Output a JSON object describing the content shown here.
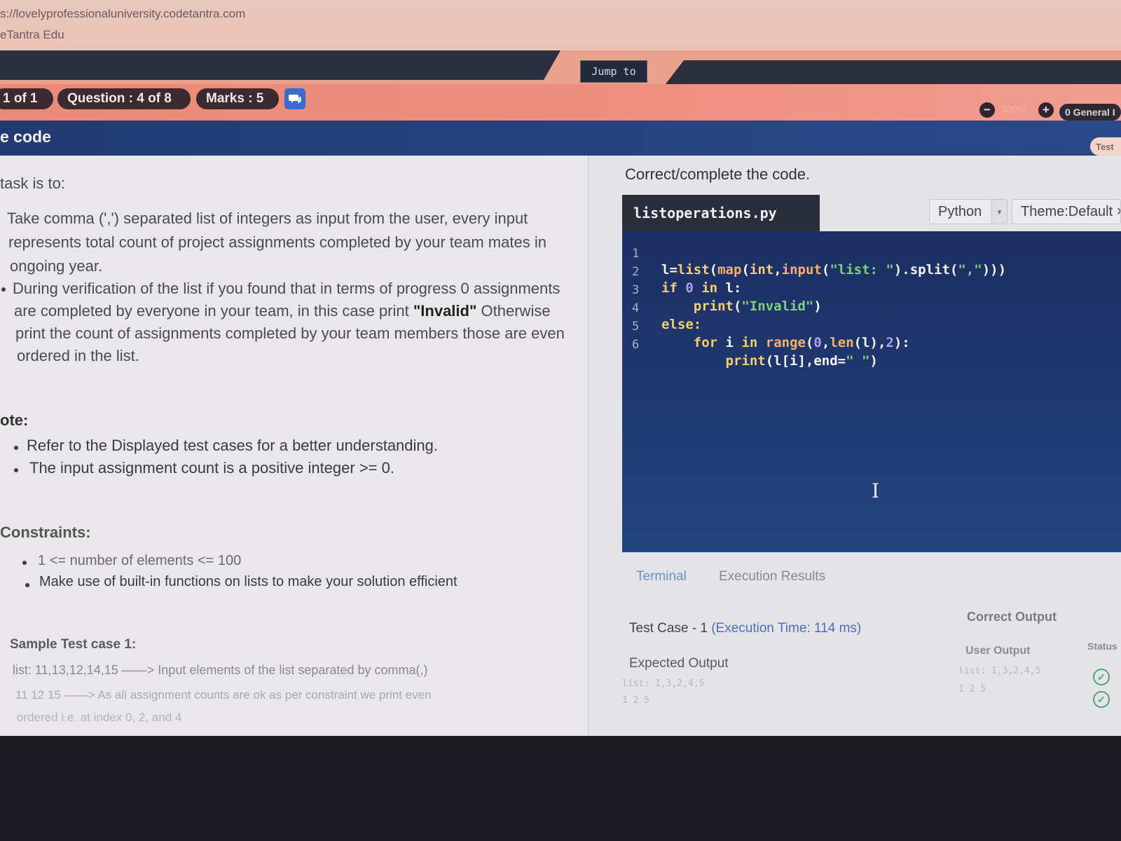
{
  "browser": {
    "url": "s://lovelyprofessionaluniversity.codetantra.com",
    "tab_title": "eTantra Edu"
  },
  "jump": {
    "label": "Jump to"
  },
  "header": {
    "section": "1 of 1",
    "question": "Question : 4 of 8",
    "marks": "Marks : 5",
    "zoom": "100%",
    "zoom_minus": "−",
    "zoom_plus": "+",
    "general": "0 General I",
    "chat_icon": "chat-icon"
  },
  "titlebar": {
    "title": "e code",
    "test_button": "Test"
  },
  "problem": {
    "intro": "task is to:",
    "para1": [
      "Take comma (',') separated list of integers as input from the user, every input",
      "represents total count of project assignments completed by your team mates in",
      "ongoing year."
    ],
    "para2": [
      "During verification of the list if you found that in terms of progress 0 assignments",
      "are completed by everyone in your team, in this case print",
      "\"Invalid\"",
      "Otherwise",
      "print the count of assignments completed by your team members those are even",
      "ordered in the list."
    ],
    "note_label": "ote:",
    "notes": [
      "Refer to the Displayed test cases for a better understanding.",
      "The input assignment count is a positive integer >= 0."
    ],
    "constraints_label": "Constraints:",
    "constraints": [
      "1 <= number of elements <= 100",
      "Make use of built-in functions on lists to make your solution efficient"
    ],
    "sample_label": "Sample Test case 1:",
    "sample_lines": [
      "list: 11,13,12,14,15 ——> Input elements of the list separated by comma(,)",
      "11 12 15 ——> As all assignment counts are ok as per constraint we  print even",
      "ordered i.e. at index 0, 2, and 4"
    ]
  },
  "editor": {
    "heading": "Correct/complete the code.",
    "filename": "listoperations.py",
    "language": "Python",
    "theme": "Theme:Default ×",
    "lines": [
      {
        "n": "1",
        "text": "l=list(map(int,input(\"list: \").split(\",\")))"
      },
      {
        "n": "2",
        "text": "if 0 in l:"
      },
      {
        "n": "3",
        "text": "    print(\"Invalid\")"
      },
      {
        "n": "4",
        "text": "else:"
      },
      {
        "n": "5",
        "text": "    for i in range(0,len(l),2):"
      },
      {
        "n": "6",
        "text": "        print(l[i],end=\" \")"
      }
    ]
  },
  "results": {
    "tabs": [
      "Terminal",
      "Execution Results"
    ],
    "testcase_title": "Test Case - 1",
    "execution_time": "(Execution Time: 114 ms)",
    "expected_label": "Expected Output",
    "correct_label": "Correct Output",
    "user_label": "User Output",
    "status_label": "Status",
    "expected_faint": "list: 1,3,2,4,5",
    "expected_faint2": "1 2 5",
    "user_faint": "list: 1,3,2,4,5",
    "user_faint2": "1 2 5"
  },
  "colors": {
    "header_salmon": "#ef8f80",
    "title_blue": "#2b4a8c",
    "editor_bg": "#1f3870",
    "pill_dark": "#3a2a31"
  }
}
